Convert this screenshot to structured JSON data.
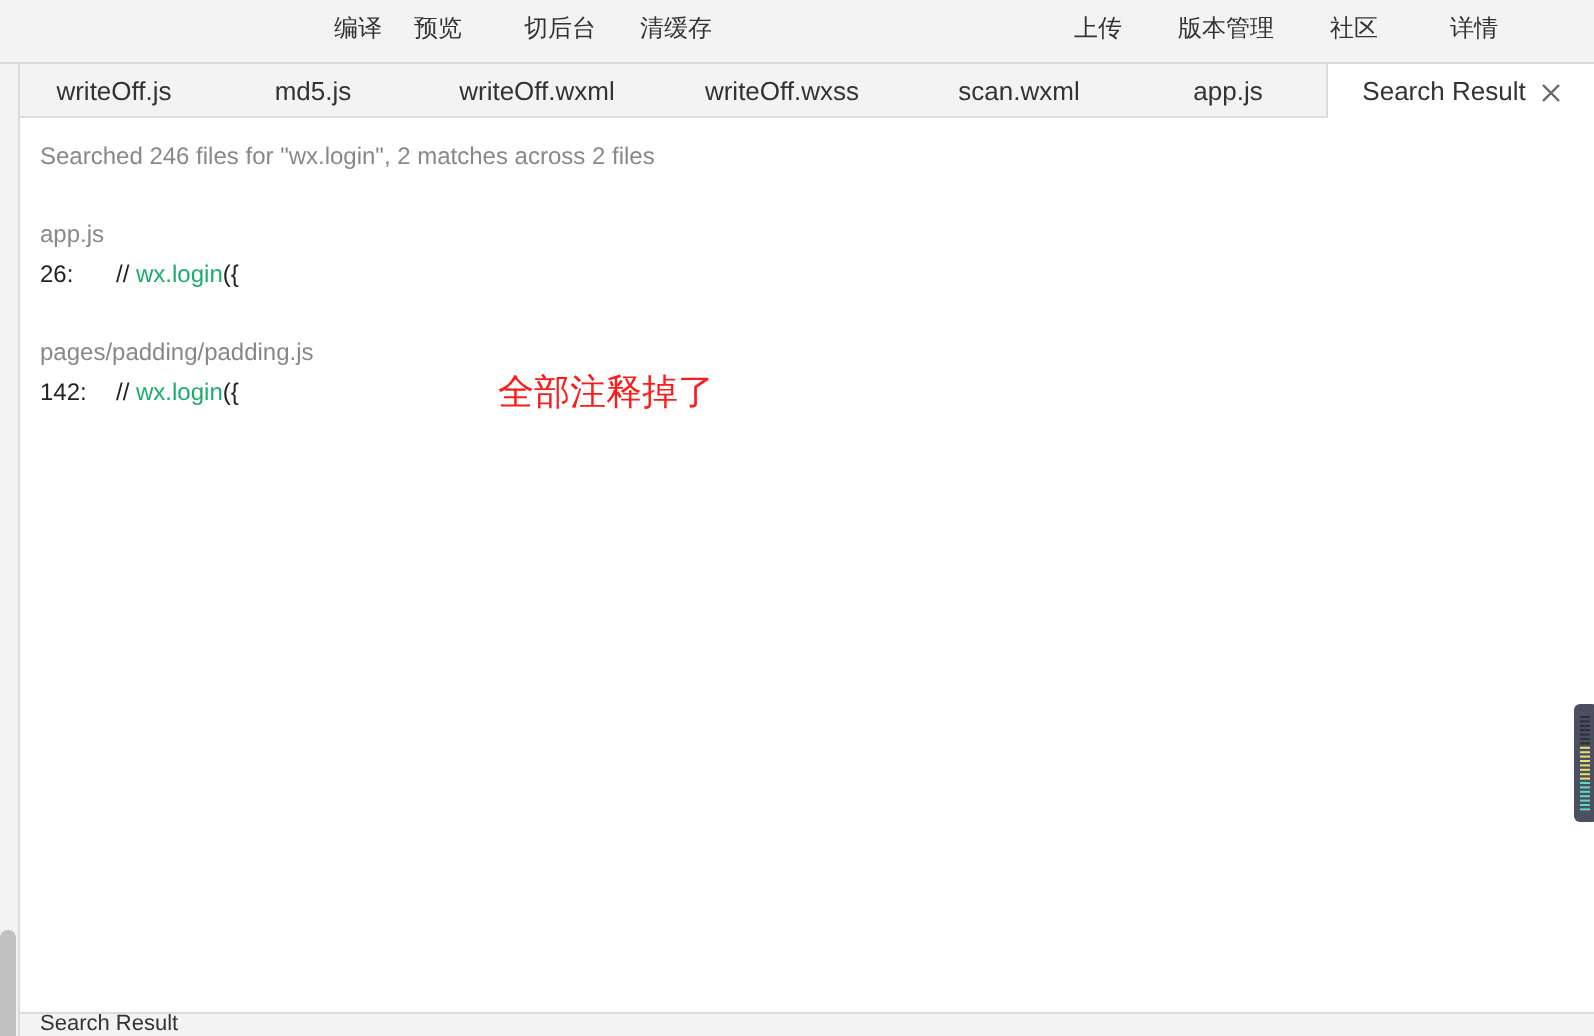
{
  "toolbar": {
    "left_buttons": [
      "编译",
      "预览",
      "切后台",
      "清缓存"
    ],
    "right_buttons": [
      "上传",
      "版本管理",
      "社区",
      "详情"
    ]
  },
  "tabs": [
    {
      "label": "writeOff.js",
      "selected": false
    },
    {
      "label": "md5.js",
      "selected": false
    },
    {
      "label": "writeOff.wxml",
      "selected": false
    },
    {
      "label": "writeOff.wxss",
      "selected": false
    },
    {
      "label": "scan.wxml",
      "selected": false
    },
    {
      "label": "app.js",
      "selected": false
    },
    {
      "label": "Search Result",
      "selected": true,
      "closable": true
    }
  ],
  "search_result": {
    "summary": "Searched 246 files for \"wx.login\", 2 matches across 2 files",
    "files": [
      {
        "path": "app.js",
        "matches": [
          {
            "line": "26:",
            "prefix": "// ",
            "match": "wx.login",
            "suffix": "({"
          }
        ]
      },
      {
        "path": "pages/padding/padding.js",
        "matches": [
          {
            "line": "142:",
            "prefix": "// ",
            "match": "wx.login",
            "suffix": "({"
          }
        ]
      }
    ]
  },
  "annotation": "全部注释掉了",
  "bottom_panel": {
    "title": "Search Result"
  }
}
